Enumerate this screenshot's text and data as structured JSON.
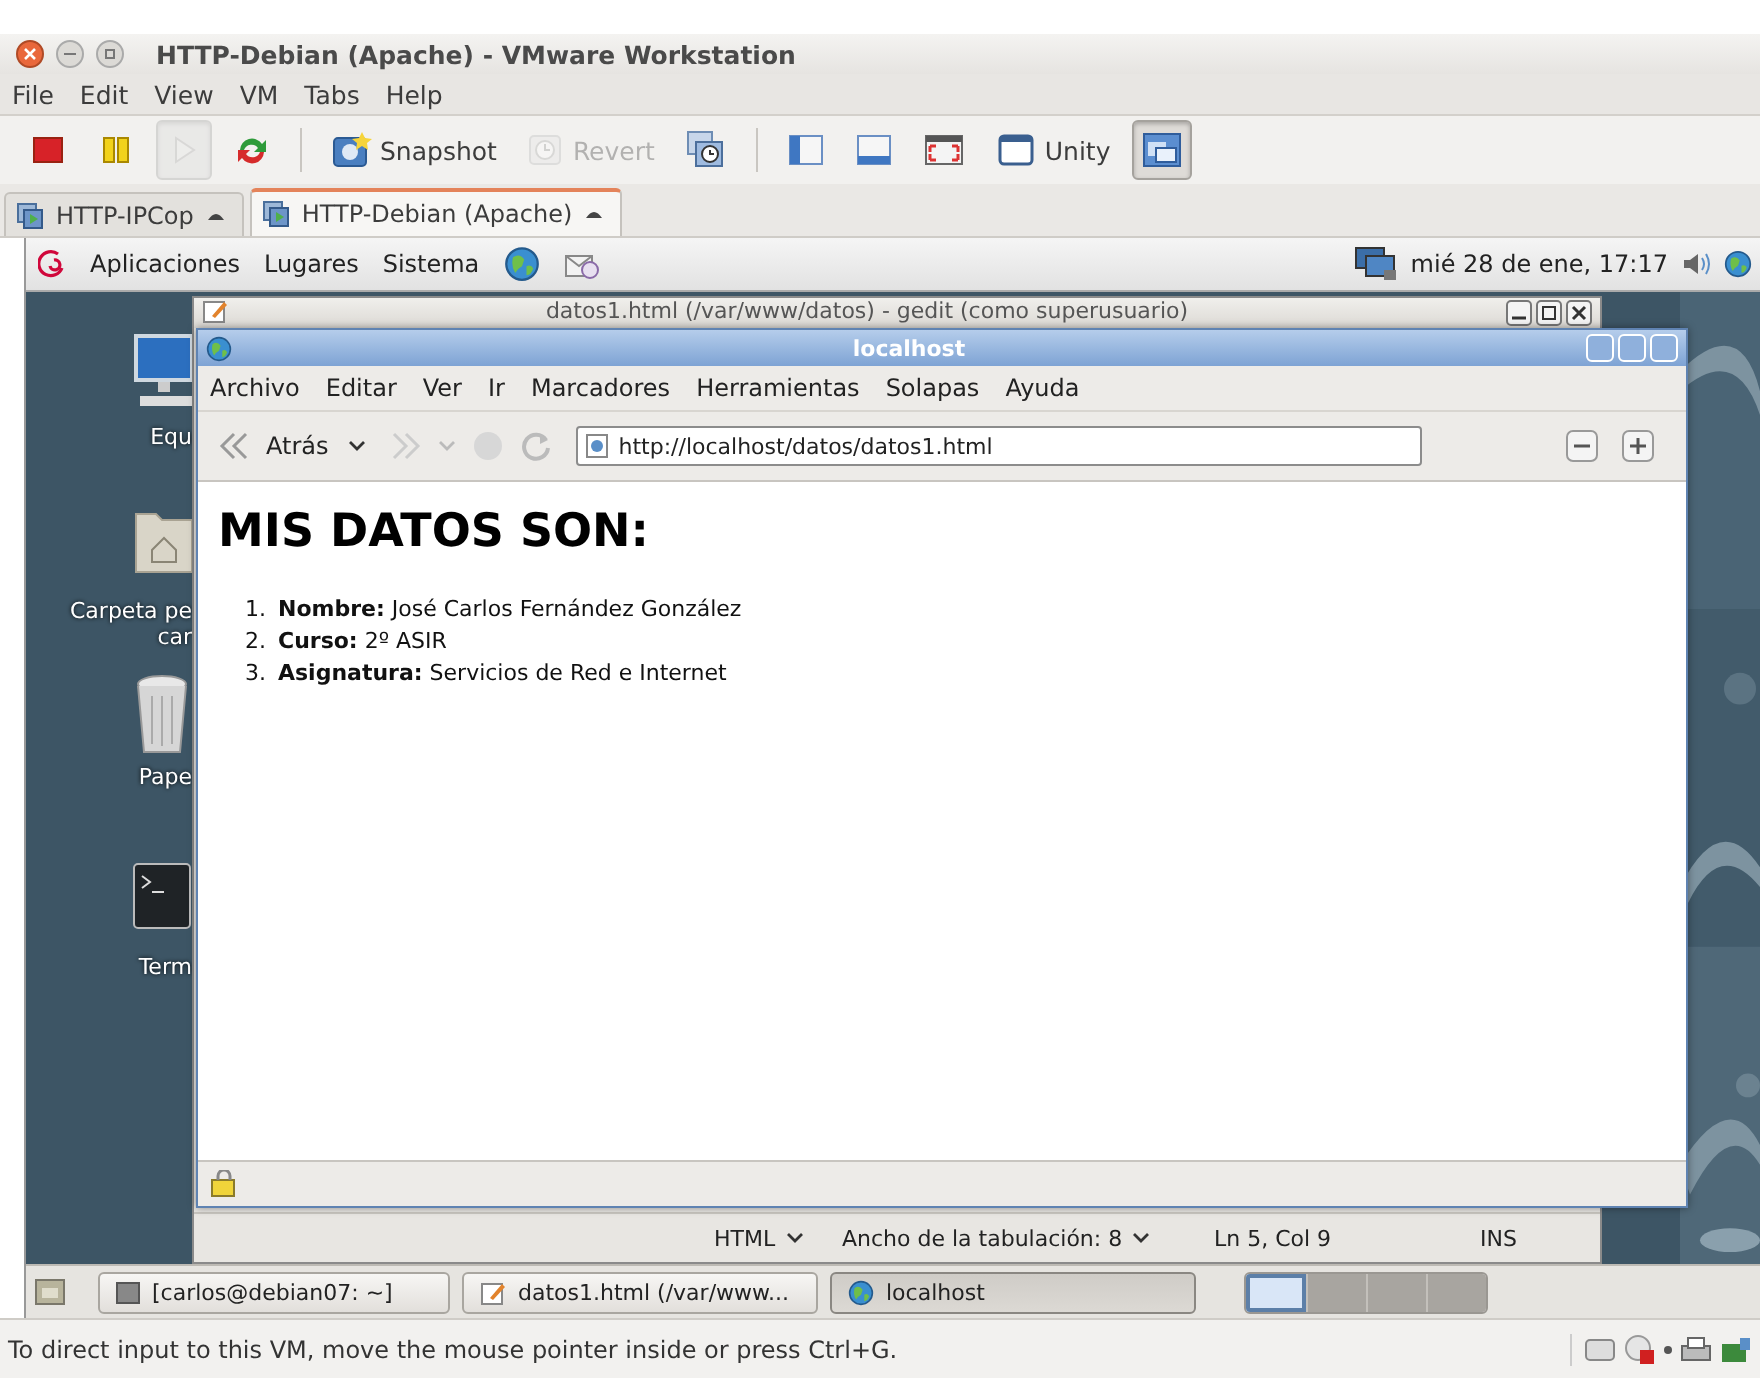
{
  "vmware": {
    "title": "HTTP-Debian (Apache) - VMware Workstation",
    "menu": [
      "File",
      "Edit",
      "View",
      "VM",
      "Tabs",
      "Help"
    ],
    "toolbar": [
      {
        "kind": "power_off",
        "disabled": false,
        "on": false
      },
      {
        "kind": "suspend",
        "disabled": false,
        "on": false
      },
      {
        "kind": "power_on",
        "disabled": true,
        "on": true
      },
      {
        "kind": "reset",
        "disabled": false,
        "on": false
      },
      {
        "kind": "separator"
      },
      {
        "kind": "snapshot",
        "label": "Snapshot",
        "disabled": false,
        "on": false
      },
      {
        "kind": "revert",
        "label": "Revert",
        "disabled": true,
        "on": false
      },
      {
        "kind": "manager",
        "disabled": false,
        "on": false
      },
      {
        "kind": "separator"
      },
      {
        "kind": "sidebar",
        "disabled": false,
        "on": false
      },
      {
        "kind": "thumbbar",
        "disabled": false,
        "on": false
      },
      {
        "kind": "fullscreen",
        "disabled": false,
        "on": false
      },
      {
        "kind": "unity",
        "label": "Unity",
        "disabled": false,
        "on": false
      },
      {
        "kind": "console",
        "disabled": false,
        "on": true
      }
    ],
    "tabs": [
      {
        "label": "HTTP-IPCop",
        "selected": false
      },
      {
        "label": "HTTP-Debian (Apache)",
        "selected": true
      }
    ],
    "status": "To direct input to this VM, move the mouse pointer inside or press Ctrl+G."
  },
  "guest": {
    "panel": {
      "menus": [
        "Aplicaciones",
        "Lugares",
        "Sistema"
      ],
      "clock": "mié 28 de ene, 17:17"
    },
    "desktop_icons": [
      {
        "kind": "computer",
        "lines": [
          "Equ"
        ]
      },
      {
        "kind": "home",
        "lines": [
          "Carpeta pe",
          "car"
        ]
      },
      {
        "kind": "trash",
        "lines": [
          "Pape"
        ]
      },
      {
        "kind": "terminal",
        "lines": [
          "Term"
        ]
      }
    ],
    "gedit": {
      "title": "datos1.html (/var/www/datos) - gedit (como superusuario)",
      "status": {
        "language": "HTML",
        "tab_width": "Ancho de la tabulación: 8",
        "position": "Ln 5, Col 9",
        "mode": "INS"
      }
    },
    "browser": {
      "title": "localhost",
      "menu": [
        "Archivo",
        "Editar",
        "Ver",
        "Ir",
        "Marcadores",
        "Herramientas",
        "Solapas",
        "Ayuda"
      ],
      "back_label": "Atrás",
      "url": "http://localhost/datos/datos1.html",
      "heading": "MIS DATOS SON:",
      "items": [
        {
          "number": "1.",
          "text": "**Nombre:** José Carlos Fernández González"
        },
        {
          "number": "2.",
          "text": "**Curso:** 2º ASIR"
        },
        {
          "number": "3.",
          "text": "**Asignatura:** Servicios de Red e Internet"
        }
      ]
    },
    "taskbar": [
      {
        "kind": "terminal",
        "label": "[carlos@debian07: ~]",
        "selected": false
      },
      {
        "kind": "editor",
        "label": "datos1.html (/var/www...",
        "selected": false
      },
      {
        "kind": "browser",
        "label": "localhost",
        "selected": true
      }
    ],
    "workspaces": [
      {
        "selected": true
      },
      {
        "selected": false
      },
      {
        "selected": false
      },
      {
        "selected": false
      }
    ]
  }
}
